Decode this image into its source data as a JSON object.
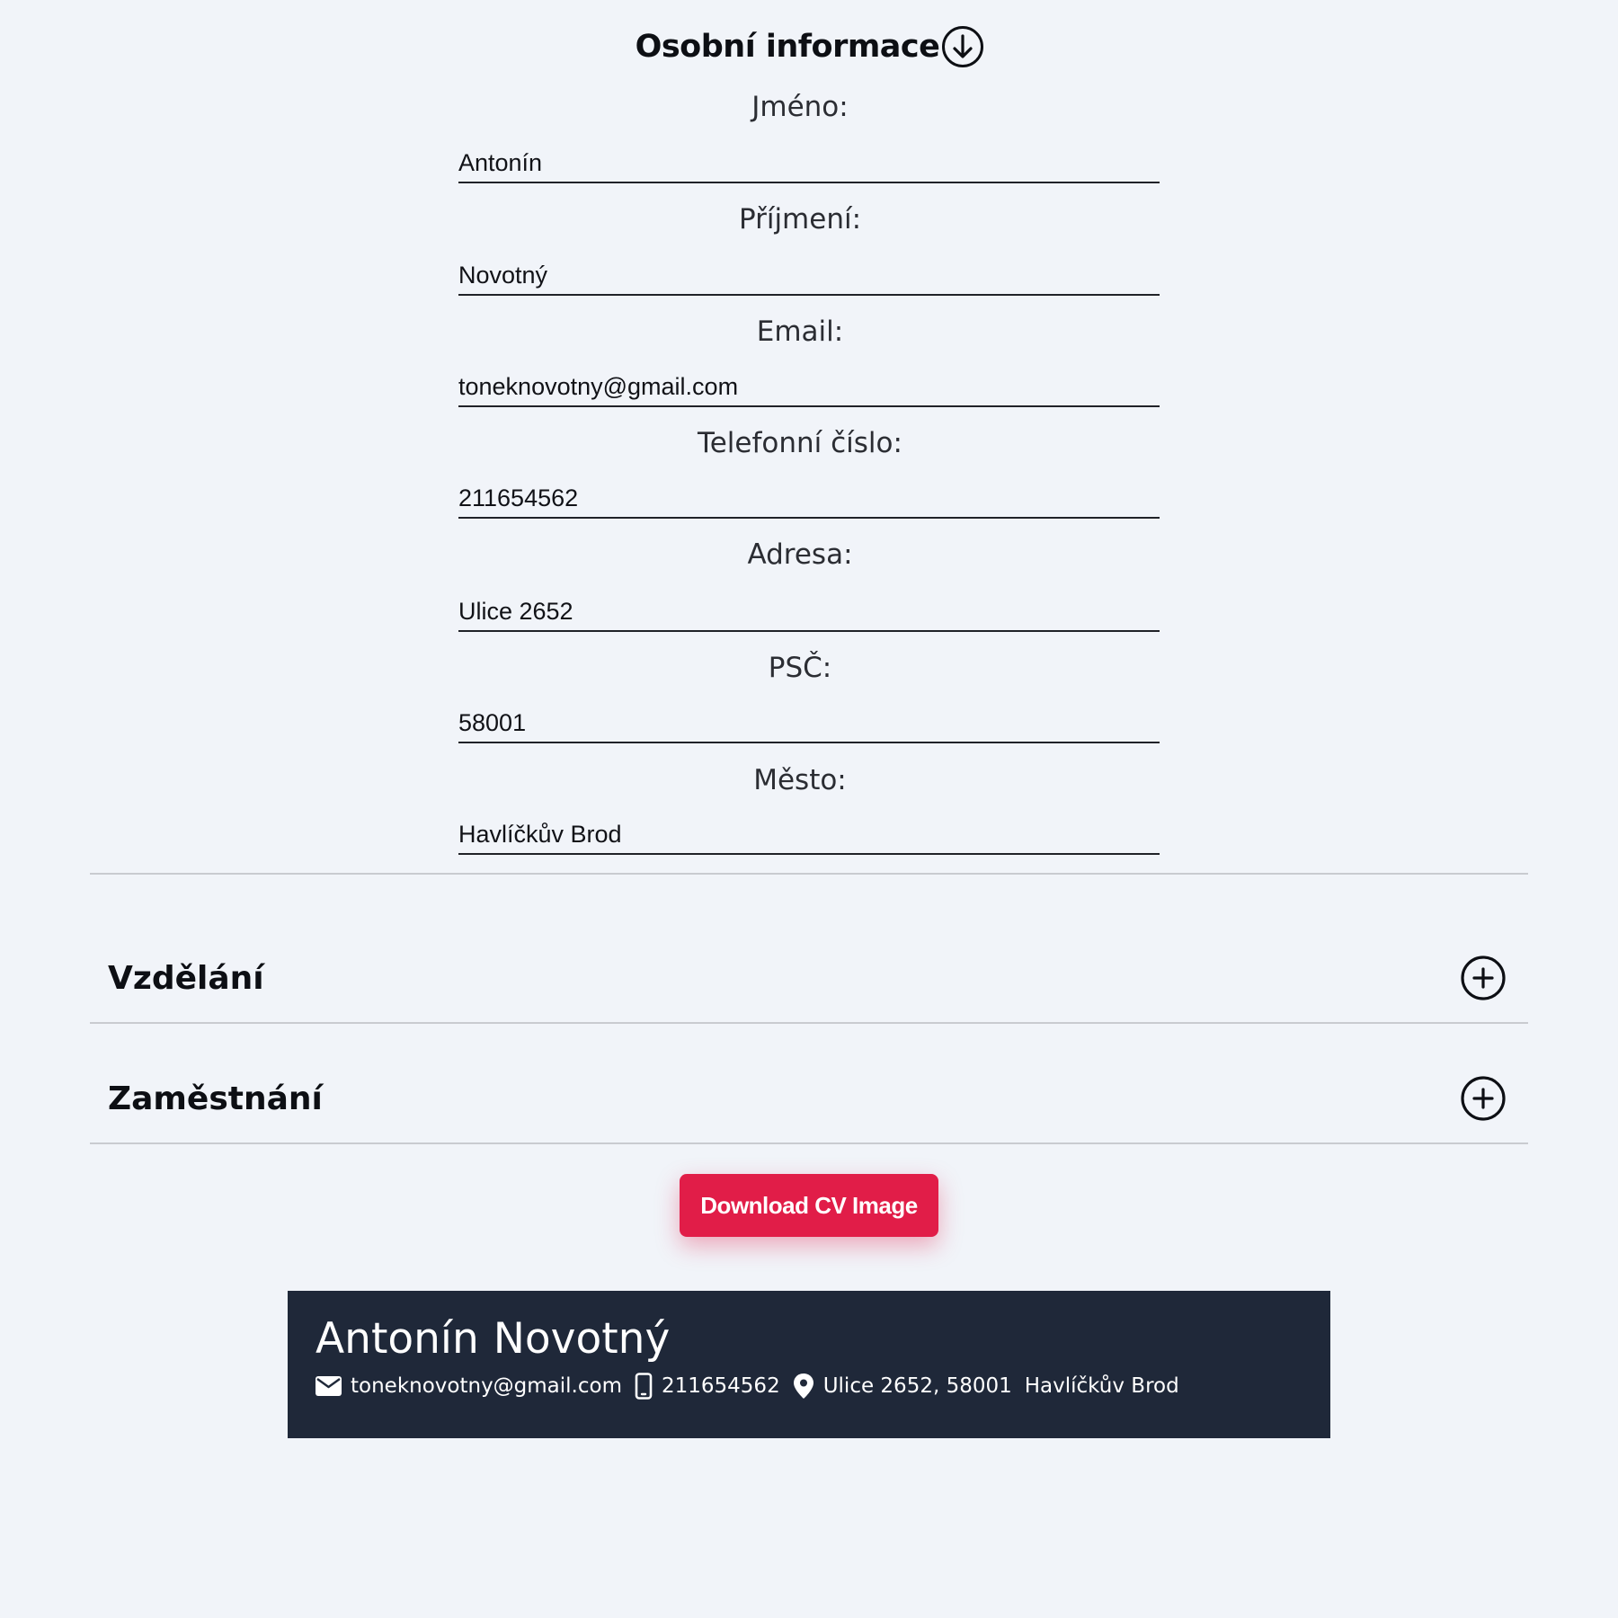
{
  "personal": {
    "title": "Osobní informace",
    "title_icon": "arrow-down-circle-icon",
    "fields": [
      {
        "label": "Jméno:",
        "value": "Antonín"
      },
      {
        "label": "Příjmení:",
        "value": "Novotný"
      },
      {
        "label": "Email:",
        "value": "toneknovotny@gmail.com"
      },
      {
        "label": "Telefonní číslo:",
        "value": "211654562"
      },
      {
        "label": "Adresa:",
        "value": "Ulice 2652"
      },
      {
        "label": "PSČ:",
        "value": "58001"
      },
      {
        "label": "Město:",
        "value": "Havlíčkův Brod"
      }
    ]
  },
  "sections": [
    {
      "title": "Vzdělání",
      "icon": "plus-circle-icon"
    },
    {
      "title": "Zaměstnání",
      "icon": "plus-circle-icon"
    }
  ],
  "download_button": {
    "label": "Download CV Image",
    "color": "#e11d48"
  },
  "cv_preview": {
    "first_name": "Antonín",
    "last_name": "Novotný",
    "email": "toneknovotny@gmail.com",
    "phone": "211654562",
    "address": "Ulice 2652, 58001",
    "city": "Havlíčkův Brod",
    "background": "#1f2839",
    "icons": [
      "envelope-icon",
      "smartphone-icon",
      "map-pin-icon"
    ]
  },
  "colors": {
    "page_background": "#f1f4f9",
    "text": "#0d0f14"
  }
}
